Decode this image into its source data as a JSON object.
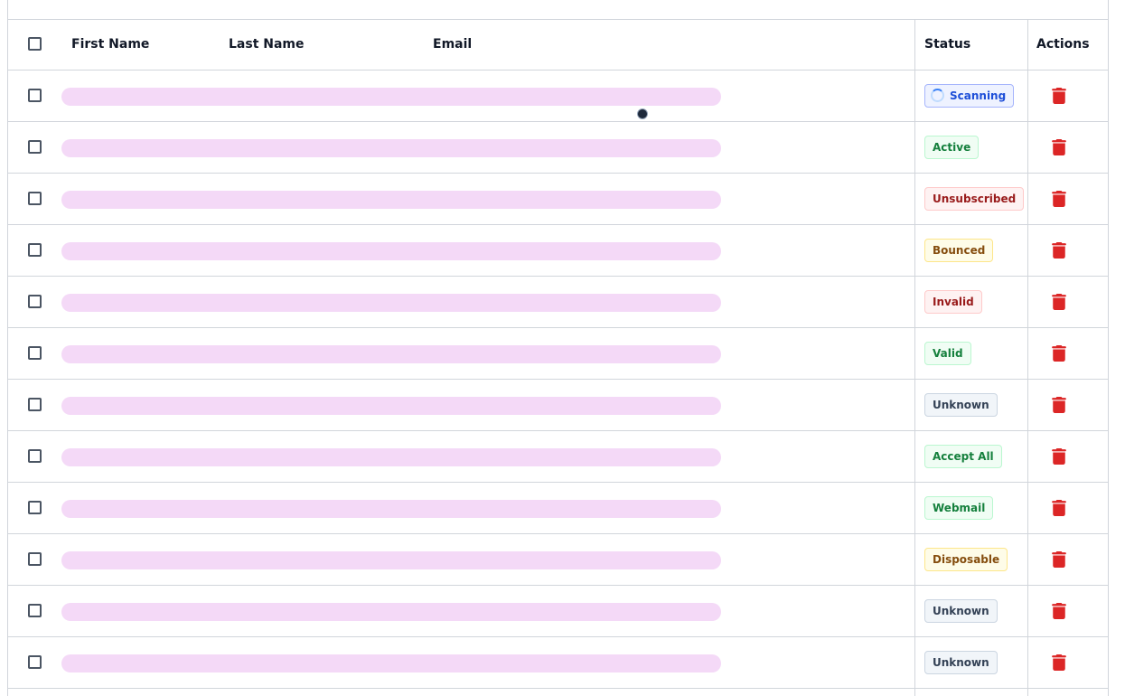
{
  "table": {
    "headers": {
      "first_name": "First Name",
      "last_name": "Last Name",
      "email": "Email",
      "status": "Status",
      "actions": "Actions"
    },
    "rows": [
      {
        "status": "Scanning",
        "variant": "blue",
        "loading": true
      },
      {
        "status": "Active",
        "variant": "green"
      },
      {
        "status": "Unsubscribed",
        "variant": "red"
      },
      {
        "status": "Bounced",
        "variant": "yellow"
      },
      {
        "status": "Invalid",
        "variant": "red"
      },
      {
        "status": "Valid",
        "variant": "green"
      },
      {
        "status": "Unknown",
        "variant": "gray"
      },
      {
        "status": "Accept All",
        "variant": "green"
      },
      {
        "status": "Webmail",
        "variant": "green"
      },
      {
        "status": "Disposable",
        "variant": "yellow"
      },
      {
        "status": "Unknown",
        "variant": "gray"
      },
      {
        "status": "Unknown",
        "variant": "gray"
      }
    ]
  },
  "icons": {
    "delete": "trash-icon",
    "loading": "spinner-icon",
    "select": "checkbox-icon"
  },
  "colors": {
    "skeleton": "#f4d9f7",
    "delete_icon": "#dc2626",
    "border": "#d1d5db"
  }
}
